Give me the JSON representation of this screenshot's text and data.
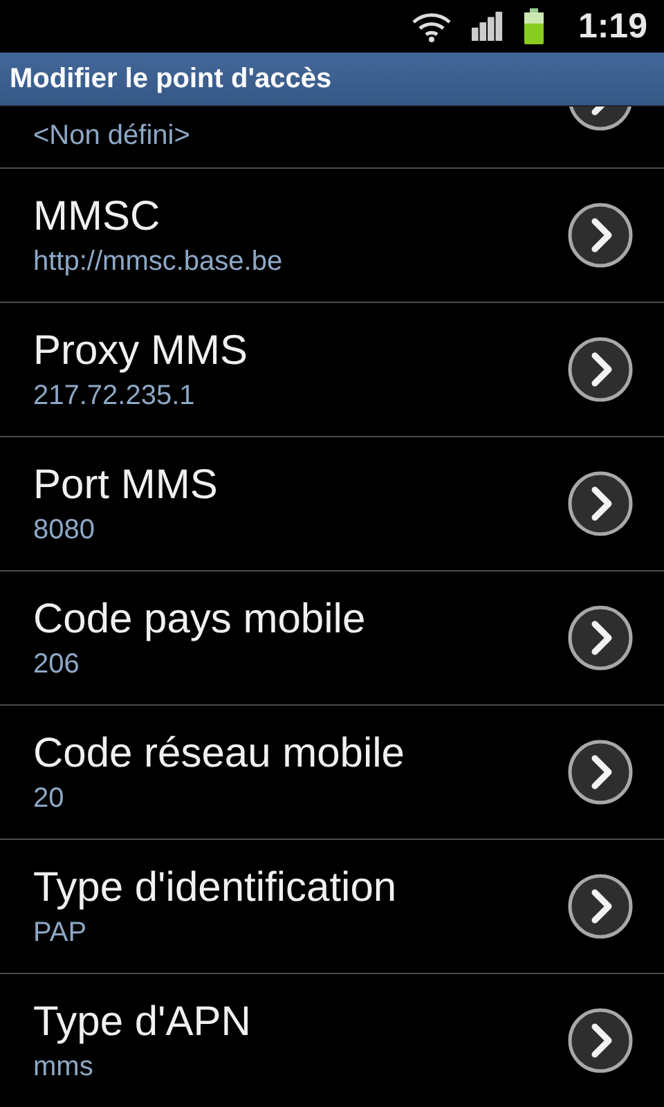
{
  "status_bar": {
    "time": "1:19"
  },
  "title": "Modifier le point d'accès",
  "items": [
    {
      "value": "<Non défini>"
    },
    {
      "label": "MMSC",
      "value": "http://mmsc.base.be"
    },
    {
      "label": "Proxy MMS",
      "value": "217.72.235.1"
    },
    {
      "label": "Port MMS",
      "value": "8080"
    },
    {
      "label": "Code pays mobile",
      "value": "206"
    },
    {
      "label": "Code réseau mobile",
      "value": "20"
    },
    {
      "label": "Type d'identification",
      "value": "PAP"
    },
    {
      "label": "Type d'APN",
      "value": "mms"
    }
  ]
}
